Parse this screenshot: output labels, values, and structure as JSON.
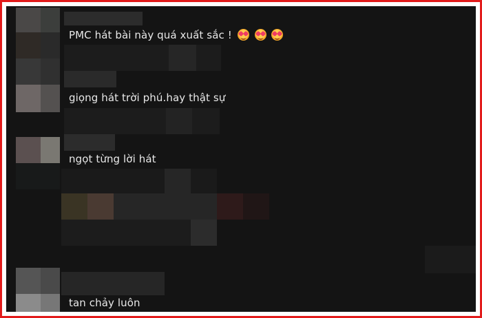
{
  "comments": [
    {
      "text": "PMC hát bài này quá xuất sắc !",
      "emojis": [
        "smiling-face-with-hearts-icon",
        "smiling-face-with-hearts-icon",
        "smiling-face-with-hearts-icon"
      ]
    },
    {
      "text": "giọng hát trời phú.hay thật sự"
    },
    {
      "text": "ngọt từng lời hát"
    },
    {
      "text": "tan chảy luôn"
    }
  ],
  "colors": {
    "frame_border": "#e21b1b",
    "background": "#141414",
    "text": "#e8e8e8"
  }
}
